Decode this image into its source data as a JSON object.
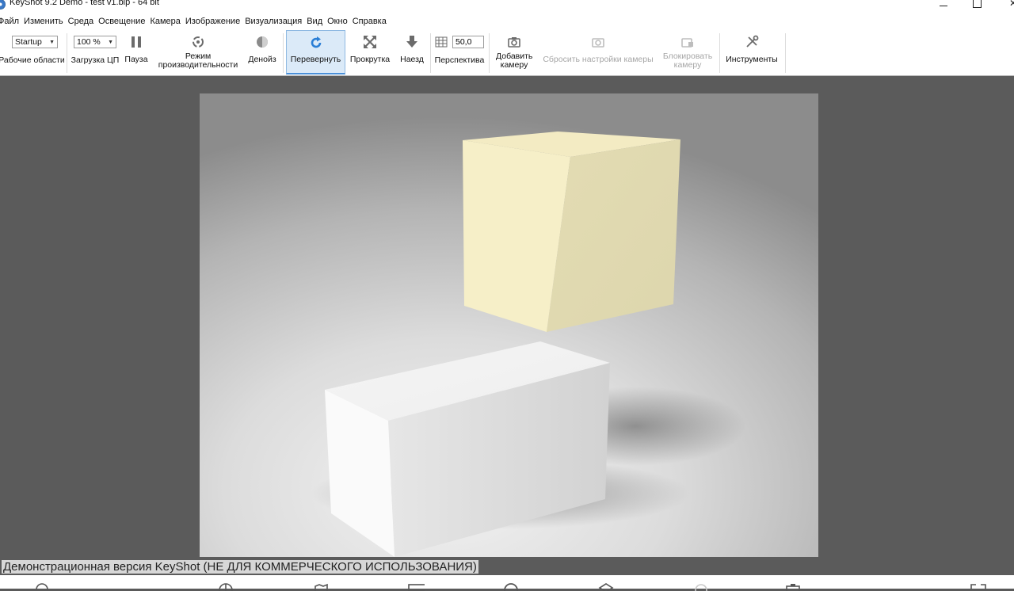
{
  "window": {
    "title": "KeyShot 9.2 Demo  - test v1.bip  - 64 bit"
  },
  "menu": [
    "Файл",
    "Изменить",
    "Среда",
    "Освещение",
    "Камера",
    "Изображение",
    "Визуализация",
    "Вид",
    "Окно",
    "Справка"
  ],
  "toolbar": {
    "workspaces": {
      "value": "Startup",
      "label": "Рабочие области"
    },
    "cpu": {
      "value": "100 %",
      "label": "Загрузка ЦП"
    },
    "pause": "Пауза",
    "performance_mode": "Режим производительности",
    "denoise": "Денойз",
    "tumble": "Перевернуть",
    "pan": "Прокрутка",
    "dolly": "Наезд",
    "perspective": {
      "value": "50,0",
      "label": "Перспектива"
    },
    "add_camera": "Добавить камеру",
    "reset_camera": "Сбросить настройки камеры",
    "lock_camera": "Блокировать камеру",
    "tools": "Инструменты"
  },
  "viewport": {
    "watermark": "Демонстрационная версия KeyShot (НЕ ДЛЯ КОММЕРЧЕСКОГО ИСПОЛЬЗОВАНИЯ)",
    "cube_color": "#f5efc4",
    "box_color": "#f4f4f4"
  },
  "colors": {
    "accent": "#4a90d9",
    "active_bg": "#dbeaf8",
    "viewport_bg": "#5b5b5b"
  }
}
